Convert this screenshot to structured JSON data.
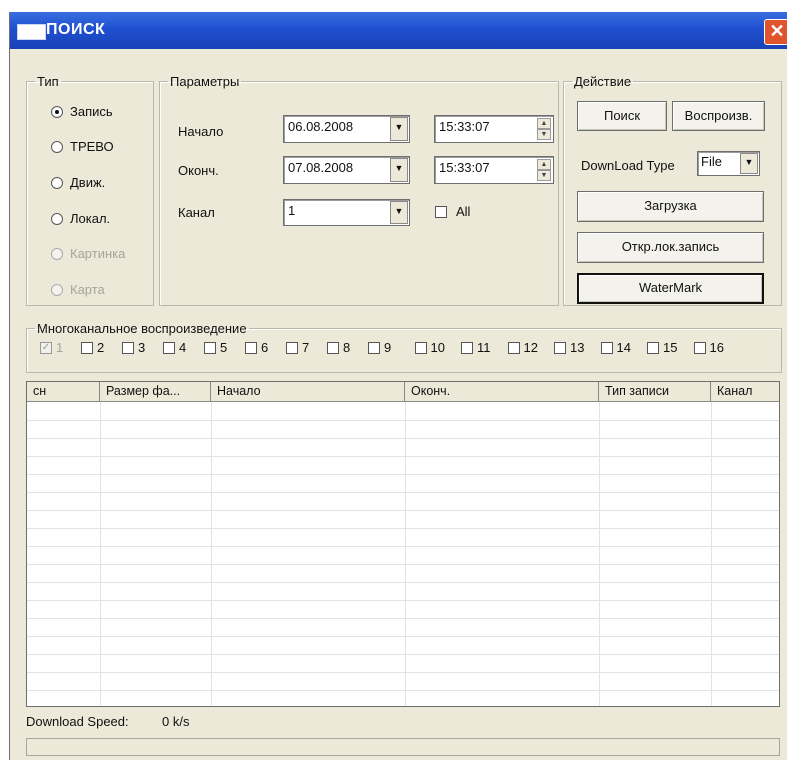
{
  "window": {
    "title": "ПОИСК",
    "close_symbol": "✕"
  },
  "type_group": {
    "legend": "Тип",
    "options": [
      {
        "label": "Запись",
        "checked": true,
        "enabled": true
      },
      {
        "label": "ТРЕВО",
        "checked": false,
        "enabled": true
      },
      {
        "label": "Движ.",
        "checked": false,
        "enabled": true
      },
      {
        "label": "Локал.",
        "checked": false,
        "enabled": true
      },
      {
        "label": "Картинка",
        "checked": false,
        "enabled": false
      },
      {
        "label": "Карта",
        "checked": false,
        "enabled": false
      }
    ]
  },
  "params_group": {
    "legend": "Параметры",
    "start_label": "Начало",
    "start_date": "06.08.2008",
    "start_time": "15:33:07",
    "end_label": "Оконч.",
    "end_date": "07.08.2008",
    "end_time": "15:33:07",
    "channel_label": "Канал",
    "channel_value": "1",
    "all_label": "All"
  },
  "action_group": {
    "legend": "Действие",
    "search_label": "Поиск",
    "play_label": "Воспроизв.",
    "download_type_label": "DownLoad Type",
    "download_type_value": "File",
    "download_label": "Загрузка",
    "open_local_label": "Откр.лок.запись",
    "watermark_label": "WaterMark"
  },
  "multichannel": {
    "legend": "Многоканальное воспроизведение",
    "channels": [
      "1",
      "2",
      "3",
      "4",
      "5",
      "6",
      "7",
      "8",
      "9",
      "10",
      "11",
      "12",
      "13",
      "14",
      "15",
      "16"
    ]
  },
  "table": {
    "columns": [
      "сн",
      "Размер фа...",
      "Начало",
      "Оконч.",
      "Тип записи",
      "Канал"
    ],
    "rows": []
  },
  "status": {
    "download_speed_label": "Download Speed:",
    "download_speed_value": "0 k/s",
    "progress": 0
  },
  "icons": {
    "dropdown": "chevron-down-icon",
    "spin_up": "spin-up-icon",
    "spin_down": "spin-down-icon"
  }
}
